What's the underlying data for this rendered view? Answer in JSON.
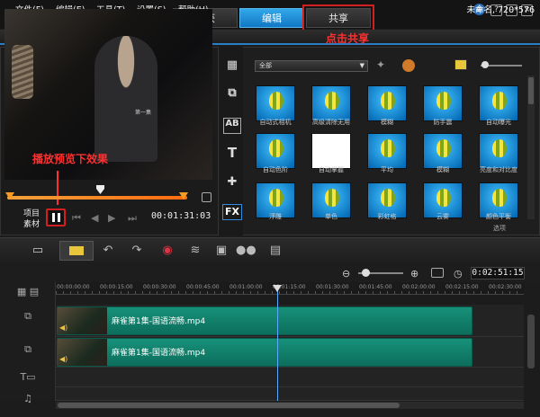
{
  "tabs": {
    "capture": "捕获",
    "edit": "编辑",
    "share": "共享"
  },
  "menu": [
    "文件(F)",
    "编辑(E)",
    "工具(T)",
    "设置(S)",
    "帮助(H)"
  ],
  "project": "未命名, 720*576",
  "annotations": {
    "click_share": "点击共享",
    "play_preview": "播放预览下效果"
  },
  "player": {
    "subtitle": "第一集",
    "mode_project": "项目",
    "mode_clip": "素材",
    "timecode": "00:01:31:03"
  },
  "library": {
    "category": "全部",
    "row1": [
      "自动式相机",
      "高级清除无用",
      "模糊",
      "防手震",
      "自动曝光"
    ],
    "row2": [
      "自动色阶",
      "自动掌握",
      "平均",
      "模糊",
      "亮度和对比度"
    ],
    "row3": [
      "浮雕",
      "单色",
      "彩虹格",
      "云雾",
      "颜色平衡"
    ],
    "options": "选项"
  },
  "timeline": {
    "timecode": "0:02:51:15",
    "ruler": [
      "00:00:00:00",
      "00:00:15:00",
      "00:00:30:00",
      "00:00:45:00",
      "00:01:00:00",
      "00:01:15:00",
      "00:01:30:00",
      "00:01:45:00",
      "00:02:00:00",
      "00:02:15:00",
      "00:02:30:00"
    ],
    "clip1": "麻雀第1集-国语流畅.mp4",
    "clip2": "麻雀第1集-国语流畅.mp4"
  },
  "colors": {
    "accent": "#1a8ee0",
    "annotation": "#ff3030",
    "clip": "#17917a",
    "scrub": "#f0a23a"
  }
}
